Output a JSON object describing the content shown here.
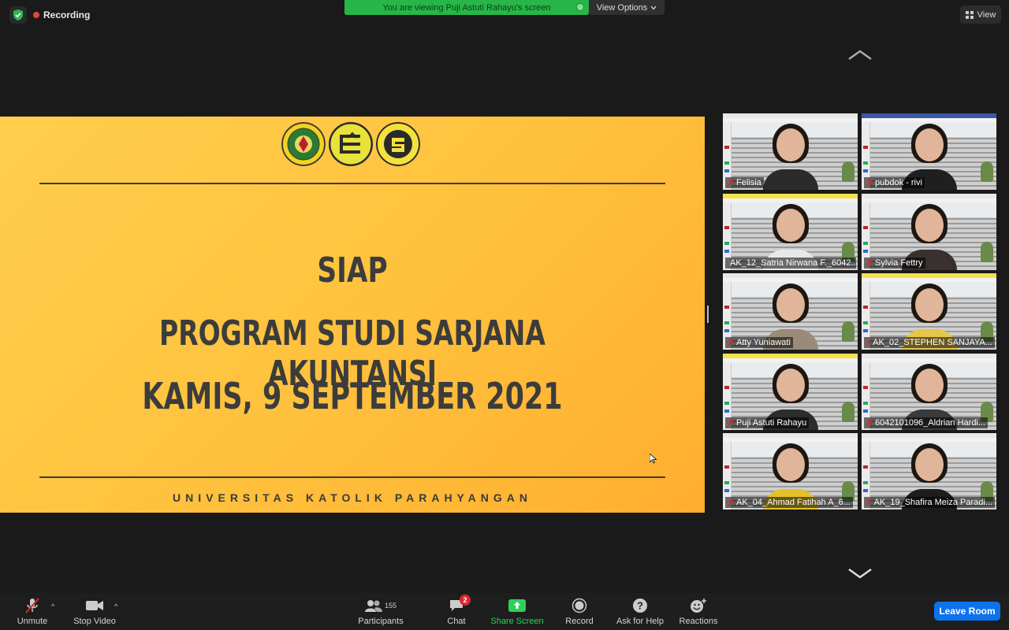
{
  "top": {
    "recording_label": "Recording",
    "viewing_banner": "You are viewing Puji Astuti Rahayu's screen",
    "view_options_label": "View Options",
    "view_button_label": "View"
  },
  "slide": {
    "title": "SIAP",
    "program": "PROGRAM STUDI SARJANA AKUNTANSI",
    "date": "KAMIS, 9 SEPTEMBER 2021",
    "footer": "UNIVERSITAS KATOLIK PARAHYANGAN",
    "background_color": "#ffc23e"
  },
  "participants": [
    {
      "name": "Felisia",
      "muted": true
    },
    {
      "name": "pubdok - rivi",
      "muted": false
    },
    {
      "name": "AK_12_Satria Nirwana F._6042...",
      "muted": false
    },
    {
      "name": "Sylvia Fettry",
      "muted": false
    },
    {
      "name": "Atty Yuniawati",
      "muted": false
    },
    {
      "name": "AK_02_STEPHEN SANJAYA...",
      "muted": true
    },
    {
      "name": "Puji Astuti Rahayu",
      "muted": false,
      "active_speaker": true
    },
    {
      "name": "6042101096_Aldrian Hardi...",
      "muted": true
    },
    {
      "name": "AK_04_Ahmad Fatihah A_6...",
      "muted": true
    },
    {
      "name": "AK_19_Shafira Meiza Paradi...",
      "muted": true
    }
  ],
  "toolbar": {
    "unmute": "Unmute",
    "stop_video": "Stop Video",
    "participants": "Participants",
    "participant_count": "155",
    "chat": "Chat",
    "chat_badge": "2",
    "share_screen": "Share Screen",
    "record": "Record",
    "ask_for_help": "Ask for Help",
    "reactions": "Reactions",
    "leave_room": "Leave Room"
  },
  "colors": {
    "share_green": "#2fd058",
    "leave_blue": "#0e72ed",
    "banner_green": "#27b648",
    "badge_red": "#e0262a"
  }
}
